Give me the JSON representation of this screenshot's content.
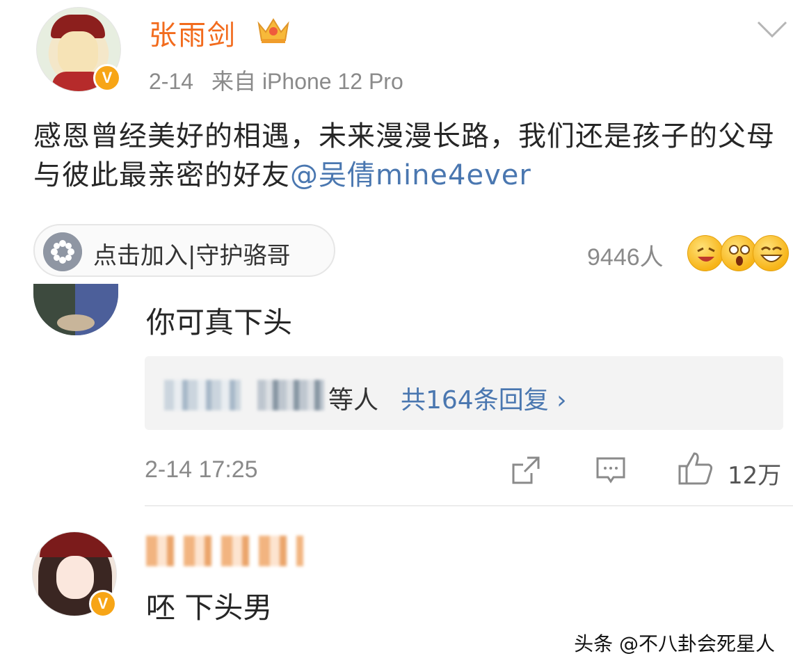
{
  "post": {
    "username": "张雨剑",
    "date": "2-14",
    "source": "来自 iPhone 12 Pro",
    "body_text": "感恩曾经美好的相遇，未来漫漫长路，我们还是孩子的父母与彼此最亲密的好友",
    "mention": "@吴倩mine4ever",
    "verified_badge": "V"
  },
  "super_topic": {
    "label": "点击加入|守护骆哥"
  },
  "reactions": {
    "count": "9446人",
    "emojis": [
      "laughing-face-icon",
      "shocked-face-icon",
      "grinning-face-icon"
    ]
  },
  "comments": [
    {
      "text": "你可真下头",
      "replies_suffix": "等人",
      "replies_link": "共164条回复 ›",
      "time": "2-14 17:25",
      "likes": "12万"
    },
    {
      "text": "呸 下头男",
      "verified_badge": "V"
    }
  ],
  "watermark": "头条 @不八卦会死星人",
  "colors": {
    "username": "#f26b1d",
    "link": "#4a77b0",
    "meta": "#8a8a8a",
    "verified": "#f7a516"
  }
}
